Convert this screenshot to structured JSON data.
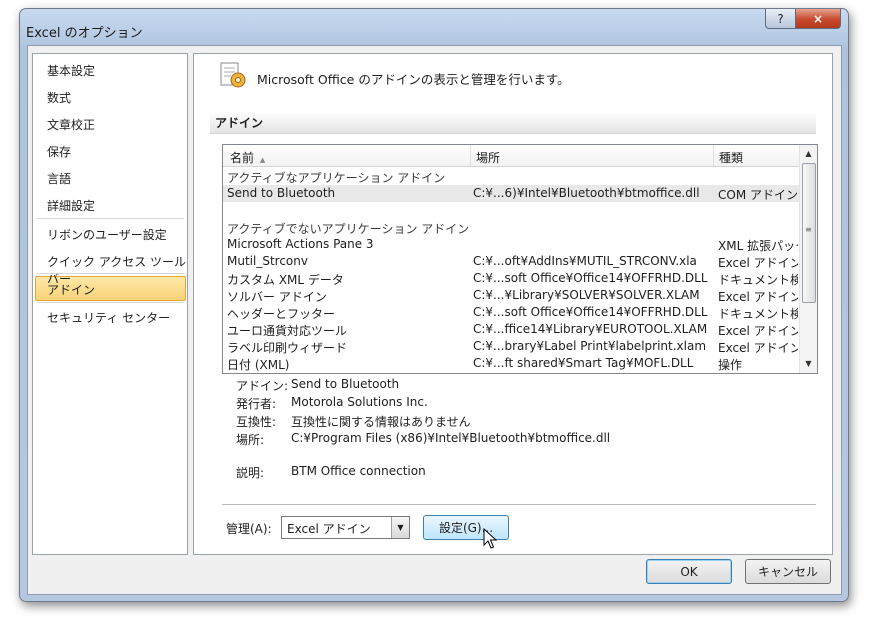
{
  "window": {
    "title": "Excel のオプション",
    "help_label": "?",
    "close_label": "×"
  },
  "sidebar": {
    "items": [
      {
        "label": "基本設定"
      },
      {
        "label": "数式"
      },
      {
        "label": "文章校正"
      },
      {
        "label": "保存"
      },
      {
        "label": "言語"
      },
      {
        "label": "詳細設定"
      },
      {
        "label": "リボンのユーザー設定"
      },
      {
        "label": "クイック アクセス ツール バー"
      },
      {
        "label": "アドイン",
        "selected": true
      },
      {
        "label": "セキュリティ センター"
      }
    ]
  },
  "main": {
    "header_text": "Microsoft Office のアドインの表示と管理を行います。",
    "section_title": "アドイン",
    "columns": {
      "name": "名前",
      "location": "場所",
      "type": "種類"
    },
    "sort_indicator": "▲",
    "groups": [
      {
        "label": "アクティブなアプリケーション アドイン",
        "rows": [
          {
            "name": "Send to Bluetooth",
            "location": "C:¥...6)¥Intel¥Bluetooth¥btmoffice.dll",
            "type": "COM アドイン",
            "selected": true
          }
        ]
      },
      {
        "label": "アクティブでないアプリケーション アドイン",
        "rows": [
          {
            "name": "Microsoft Actions Pane 3",
            "location": "",
            "type": "XML 拡張パック"
          },
          {
            "name": "Mutil_Strconv",
            "location": "C:¥...oft¥AddIns¥MUTIL_STRCONV.xla",
            "type": "Excel アドイン"
          },
          {
            "name": "カスタム XML データ",
            "location": "C:¥...soft Office¥Office14¥OFFRHD.DLL",
            "type": "ドキュメント検査"
          },
          {
            "name": "ソルバー アドイン",
            "location": "C:¥...¥Library¥SOLVER¥SOLVER.XLAM",
            "type": "Excel アドイン"
          },
          {
            "name": "ヘッダーとフッター",
            "location": "C:¥...soft Office¥Office14¥OFFRHD.DLL",
            "type": "ドキュメント検査"
          },
          {
            "name": "ユーロ通貨対応ツール",
            "location": "C:¥...ffice14¥Library¥EUROTOOL.XLAM",
            "type": "Excel アドイン"
          },
          {
            "name": "ラベル印刷ウィザード",
            "location": "C:¥...brary¥Label Print¥labelprint.xlam",
            "type": "Excel アドイン"
          },
          {
            "name": "日付 (XML)",
            "location": "C:¥...ft shared¥Smart Tag¥MOFL.DLL",
            "type": "操作"
          }
        ]
      }
    ],
    "details": {
      "addin_label": "アドイン:",
      "addin_value": "Send to Bluetooth",
      "publisher_label": "発行者:",
      "publisher_value": "Motorola Solutions Inc.",
      "compat_label": "互換性:",
      "compat_value": "互換性に関する情報はありません",
      "location_label": "場所:",
      "location_value": "C:¥Program Files (x86)¥Intel¥Bluetooth¥btmoffice.dll",
      "desc_label": "説明:",
      "desc_value": "BTM Office connection"
    },
    "manage": {
      "label": "管理(A):",
      "value": "Excel アドイン",
      "go_label": "設定(G)..."
    }
  },
  "footer": {
    "ok_label": "OK",
    "cancel_label": "キャンセル"
  },
  "colors": {
    "selection": "#f8d378",
    "selection_border": "#e2a735",
    "button_border": "#3c7fb1"
  }
}
